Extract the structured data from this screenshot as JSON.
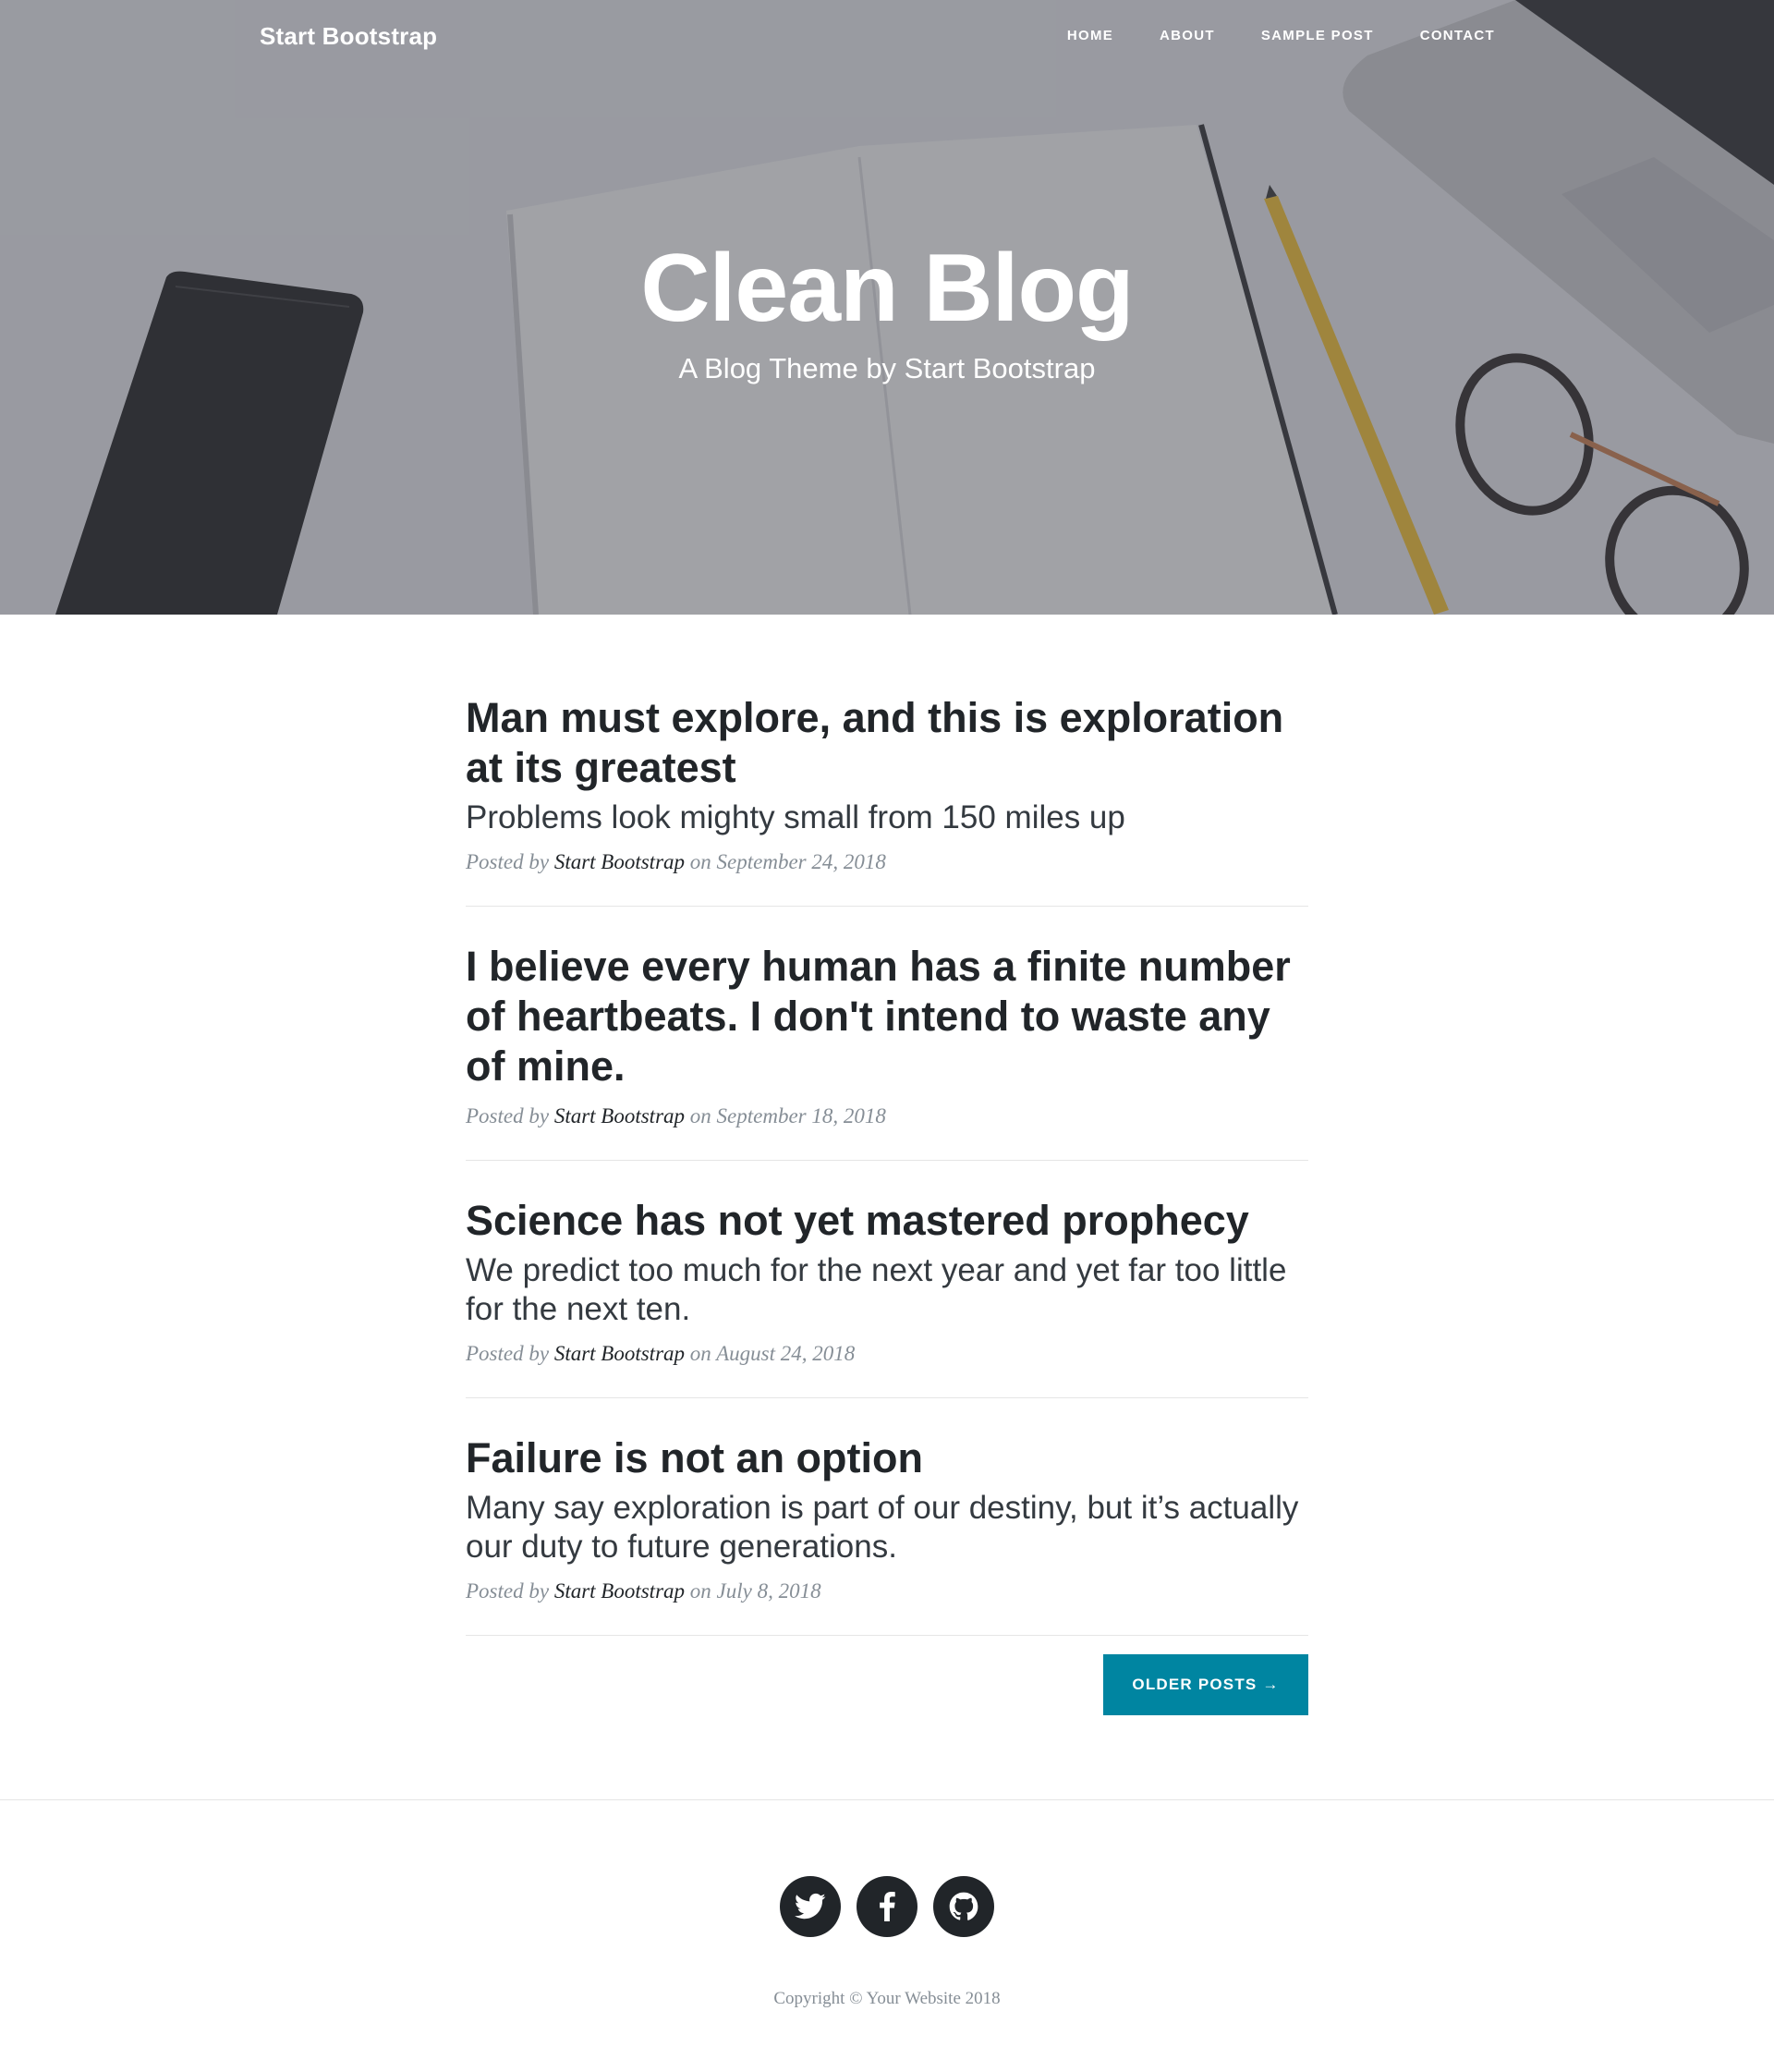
{
  "navbar": {
    "brand": "Start Bootstrap",
    "links": [
      "Home",
      "About",
      "Sample Post",
      "Contact"
    ]
  },
  "hero": {
    "title": "Clean Blog",
    "subtitle": "A Blog Theme by Start Bootstrap"
  },
  "posts": [
    {
      "title": "Man must explore, and this is exploration at its greatest",
      "subtitle": "Problems look mighty small from 150 miles up",
      "meta_prefix": "Posted by",
      "author": "Start Bootstrap",
      "meta_on": "on",
      "date": "September 24, 2018"
    },
    {
      "title": "I believe every human has a finite number of heartbeats. I don't intend to waste any of mine.",
      "subtitle": "",
      "meta_prefix": "Posted by",
      "author": "Start Bootstrap",
      "meta_on": "on",
      "date": "September 18, 2018"
    },
    {
      "title": "Science has not yet mastered prophecy",
      "subtitle": "We predict too much for the next year and yet far too little for the next ten.",
      "meta_prefix": "Posted by",
      "author": "Start Bootstrap",
      "meta_on": "on",
      "date": "August 24, 2018"
    },
    {
      "title": "Failure is not an option",
      "subtitle": "Many say exploration is part of our destiny, but it’s actually our duty to future generations.",
      "meta_prefix": "Posted by",
      "author": "Start Bootstrap",
      "meta_on": "on",
      "date": "July 8, 2018"
    }
  ],
  "pager": {
    "older_label": "Older Posts →"
  },
  "footer": {
    "social_icons": [
      "twitter-icon",
      "facebook-icon",
      "github-icon"
    ],
    "copyright": "Copyright © Your Website 2018"
  },
  "colors": {
    "accent": "#0085a1",
    "text": "#212529",
    "muted": "#868e96"
  }
}
